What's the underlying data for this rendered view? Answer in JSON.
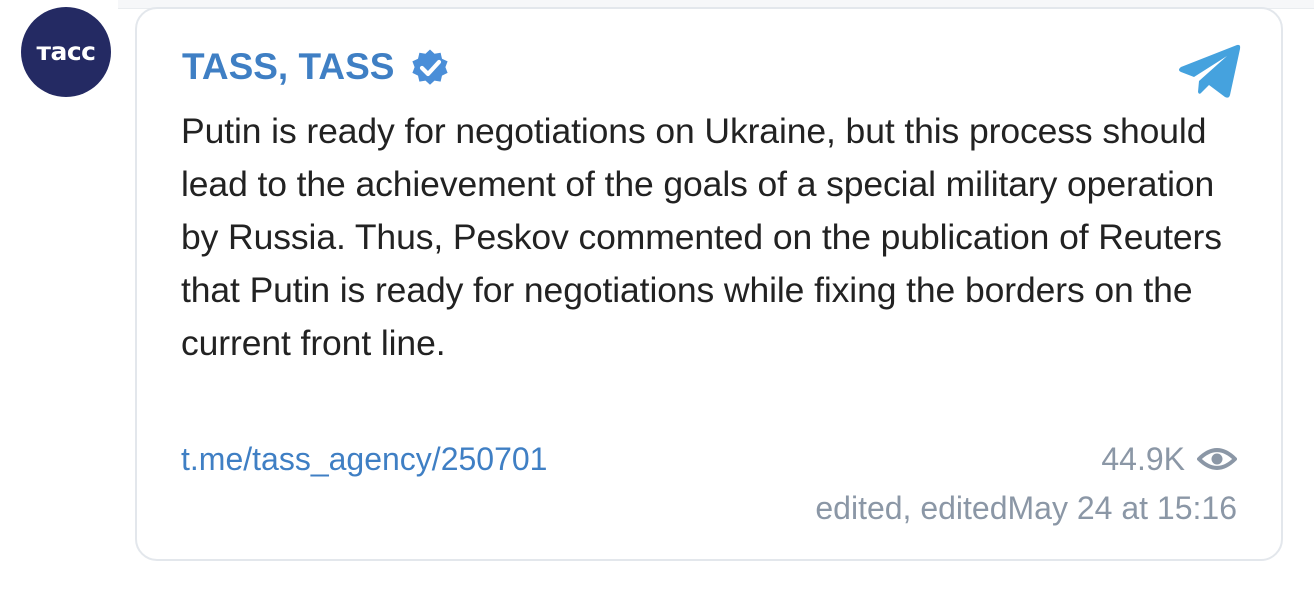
{
  "avatar": {
    "label": "тасс",
    "bg_color": "#242a63"
  },
  "header": {
    "channel_name": "TASS, TASS",
    "verified_icon": "verified-badge-icon",
    "platform_icon": "telegram-icon"
  },
  "message": {
    "text": "Putin is ready for negotiations on Ukraine, but this process should lead to the achievement of the goals of a special military operation by Russia. Thus, Peskov commented on the publication of Reuters that Putin is ready for negotiations while fixing the borders on the current front line."
  },
  "footer": {
    "link": "t.me/tass_agency/250701",
    "views": "44.9K",
    "views_icon": "eye-icon",
    "edited": "edited, editedMay 24 at 15:16"
  },
  "colors": {
    "accent": "#3f7fc4",
    "muted": "#8b97a6",
    "text": "#222222",
    "card_border": "#e3e7ec"
  }
}
